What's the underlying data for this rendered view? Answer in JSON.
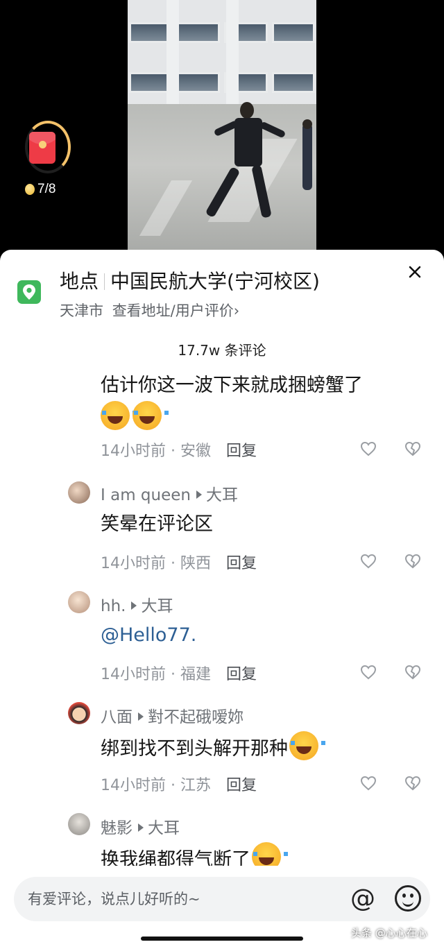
{
  "video": {
    "coin_counter": "7/8",
    "icons": {
      "red_packet": "red-envelope-icon",
      "coin": "gold-coin-icon"
    }
  },
  "location": {
    "label": "地点",
    "name": "中国民航大学(宁河校区)",
    "city": "天津市",
    "link_text": "查看地址/用户评价",
    "link_chevron": "›",
    "icon": "map-pin-icon",
    "accent": "#3fb85c"
  },
  "comments_header": {
    "count": "17.7w 条评论"
  },
  "comments": [
    {
      "text": "估计你这一波下来就成捆螃蟹了",
      "time": "14小时前",
      "region": "安徽",
      "reply": "回复"
    },
    {
      "author": "I am queen",
      "reply_to": "大耳",
      "text": "笑晕在评论区",
      "time": "14小时前",
      "region": "陕西",
      "reply": "回复"
    },
    {
      "author": "hh.",
      "reply_to": "大耳",
      "text": "@Hello77.",
      "time": "14小时前",
      "region": "福建",
      "reply": "回复"
    },
    {
      "author": "八面",
      "reply_to": "對不起硪嗳妳",
      "text": "绑到找不到头解开那种",
      "time": "14小时前",
      "region": "江苏",
      "reply": "回复"
    },
    {
      "author": "魅影",
      "reply_to": "大耳",
      "text": "换我绳都得气断了"
    }
  ],
  "meta_separator": "·",
  "input": {
    "placeholder": "有爱评论，说点儿好听的~",
    "at_symbol": "@"
  },
  "watermark": "头条 @心心在心",
  "colors": {
    "mention": "#2d5f94",
    "sheet": "#ffffff",
    "red_packet": "#ee3b46"
  }
}
